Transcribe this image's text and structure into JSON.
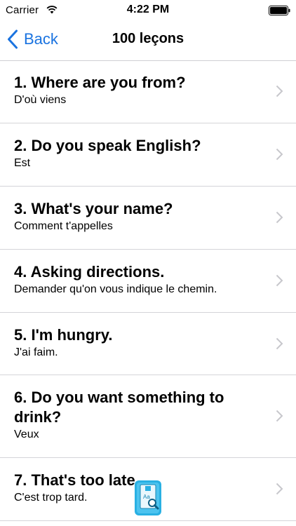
{
  "status_bar": {
    "carrier": "Carrier",
    "time": "4:22 PM"
  },
  "nav": {
    "back_label": "Back",
    "title": "100 leçons",
    "accent_color": "#1a73e0"
  },
  "lessons": [
    {
      "title": "1. Where are you from?",
      "subtitle": "D'où viens"
    },
    {
      "title": "2. Do you speak English?",
      "subtitle": "Est"
    },
    {
      "title": "3. What's your name?",
      "subtitle": "Comment t'appelles"
    },
    {
      "title": "4. Asking directions.",
      "subtitle": "Demander qu'on vous indique le chemin."
    },
    {
      "title": "5. I'm hungry.",
      "subtitle": "J'ai faim."
    },
    {
      "title": "6. Do you want something to drink?",
      "subtitle": "Veux"
    },
    {
      "title": "7. That's too late.",
      "subtitle": "C'est trop tard."
    }
  ],
  "dictionary_icon": {
    "icon": "dictionary-search-icon",
    "glyph": "Aa"
  }
}
